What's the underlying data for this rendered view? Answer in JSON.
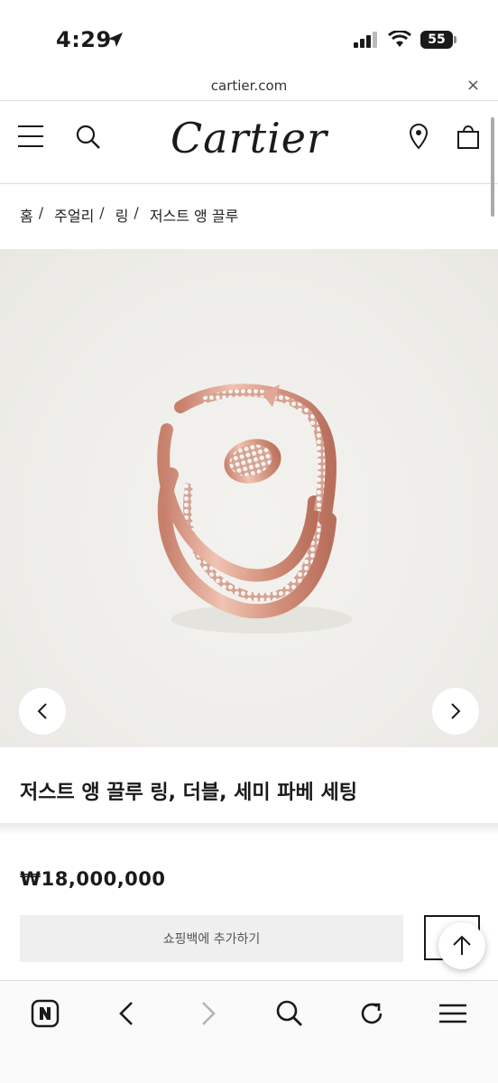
{
  "status_bar": {
    "time": "4:29",
    "battery": "55"
  },
  "url_bar": {
    "url": "cartier.com",
    "close_label": "×"
  },
  "header": {
    "logo": "Cartier"
  },
  "breadcrumb": {
    "items": [
      "홈",
      "주얼리",
      "링",
      "저스트 앵 끌루"
    ],
    "separator": "/"
  },
  "product": {
    "title": "저스트 앵 끌루 링, 더블, 세미 파베 세팅",
    "price": "₩18,000,000",
    "add_to_bag_label": "쇼핑백에 추가하기"
  },
  "colors": {
    "accent": "#1a1a1a",
    "button_bg": "#efefef",
    "ring": "#d99a86"
  },
  "icons": {
    "header": [
      "menu-icon",
      "search-icon",
      "location-pin-icon",
      "shopping-bag-icon"
    ],
    "toolbar": [
      "naver-icon",
      "back-icon",
      "forward-icon",
      "search-icon",
      "reload-icon",
      "menu-icon"
    ]
  }
}
